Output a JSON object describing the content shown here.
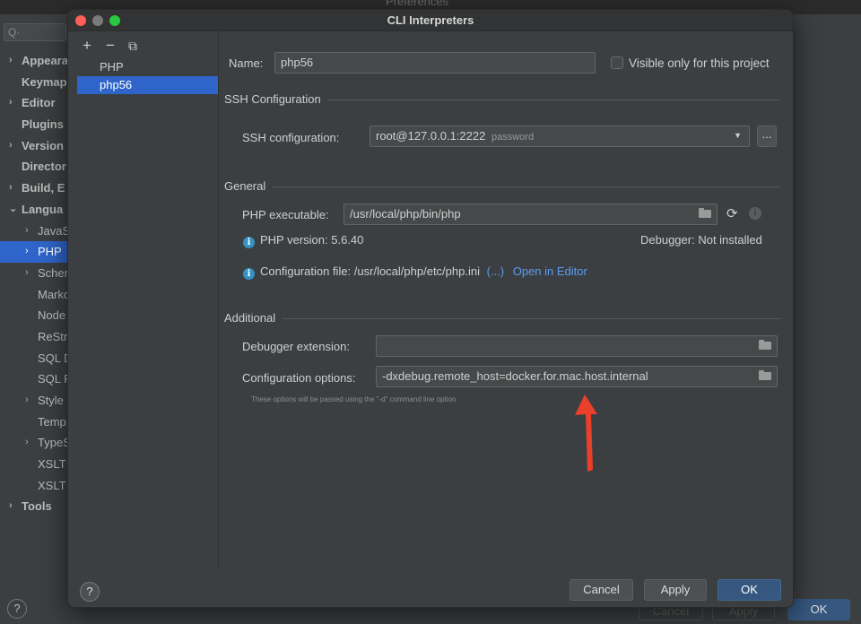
{
  "background": {
    "title": "Preferences",
    "search_placeholder": "Q·",
    "tree": [
      {
        "label": "Appearan",
        "bold": true,
        "arrow": "›",
        "indent": 0
      },
      {
        "label": "Keymap",
        "bold": true,
        "arrow": "",
        "indent": 0
      },
      {
        "label": "Editor",
        "bold": true,
        "arrow": "›",
        "indent": 0
      },
      {
        "label": "Plugins",
        "bold": true,
        "arrow": "",
        "indent": 0
      },
      {
        "label": "Version",
        "bold": true,
        "arrow": "›",
        "indent": 0
      },
      {
        "label": "Director",
        "bold": true,
        "arrow": "",
        "indent": 0
      },
      {
        "label": "Build, E",
        "bold": true,
        "arrow": "›",
        "indent": 0
      },
      {
        "label": "Langua",
        "bold": true,
        "arrow": "⌄",
        "indent": 0
      },
      {
        "label": "JavaS",
        "bold": false,
        "arrow": "›",
        "indent": 1
      },
      {
        "label": "PHP",
        "bold": false,
        "arrow": "›",
        "indent": 1,
        "selected": true
      },
      {
        "label": "Scher",
        "bold": false,
        "arrow": "›",
        "indent": 1
      },
      {
        "label": "Marko",
        "bold": false,
        "arrow": "",
        "indent": 1
      },
      {
        "label": "Node",
        "bold": false,
        "arrow": "",
        "indent": 1
      },
      {
        "label": "ReStr",
        "bold": false,
        "arrow": "",
        "indent": 1
      },
      {
        "label": "SQL D",
        "bold": false,
        "arrow": "",
        "indent": 1
      },
      {
        "label": "SQL R",
        "bold": false,
        "arrow": "",
        "indent": 1
      },
      {
        "label": "Style",
        "bold": false,
        "arrow": "›",
        "indent": 1
      },
      {
        "label": "Temp",
        "bold": false,
        "arrow": "",
        "indent": 1
      },
      {
        "label": "TypeS",
        "bold": false,
        "arrow": "›",
        "indent": 1
      },
      {
        "label": "XSLT",
        "bold": false,
        "arrow": "",
        "indent": 1
      },
      {
        "label": "XSLT",
        "bold": false,
        "arrow": "",
        "indent": 1
      },
      {
        "label": "Tools",
        "bold": true,
        "arrow": "›",
        "indent": 0
      }
    ],
    "help_label": "?",
    "cancel_label": "Cancel",
    "apply_label": "Apply",
    "ok_label": "OK"
  },
  "dialog": {
    "title": "CLI Interpreters",
    "toolbar": {
      "add": "+",
      "remove": "−",
      "copy": "⧉"
    },
    "interpreters": [
      {
        "label": "PHP",
        "selected": false
      },
      {
        "label": "php56",
        "selected": true
      }
    ],
    "name_label": "Name:",
    "name_value": "php56",
    "visible_only_label": "Visible only for this project",
    "ssh_section": "SSH Configuration",
    "ssh_label": "SSH configuration:",
    "ssh_value": "root@127.0.0.1:2222",
    "ssh_auth": "password",
    "ssh_more": "...",
    "general_section": "General",
    "php_exec_label": "PHP executable:",
    "php_exec_value": "/usr/local/php/bin/php",
    "php_version": "PHP version: 5.6.40",
    "debugger": "Debugger: Not installed",
    "config_file": "Configuration file: /usr/local/php/etc/php.ini",
    "config_more": "(...)",
    "open_in_editor": "Open in Editor",
    "additional_section": "Additional",
    "debugger_ext_label": "Debugger extension:",
    "debugger_ext_value": "",
    "config_options_label": "Configuration options:",
    "config_options_value": "-dxdebug.remote_host=docker.for.mac.host.internal",
    "hint": "These options will be passed using the \"-d\" command line option",
    "help_label": "?",
    "cancel_label": "Cancel",
    "apply_label": "Apply",
    "ok_label": "OK"
  },
  "colors": {
    "accent": "#2f65ca",
    "primary_button": "#365880",
    "link": "#589df6",
    "annotation_arrow": "#e8402a"
  }
}
